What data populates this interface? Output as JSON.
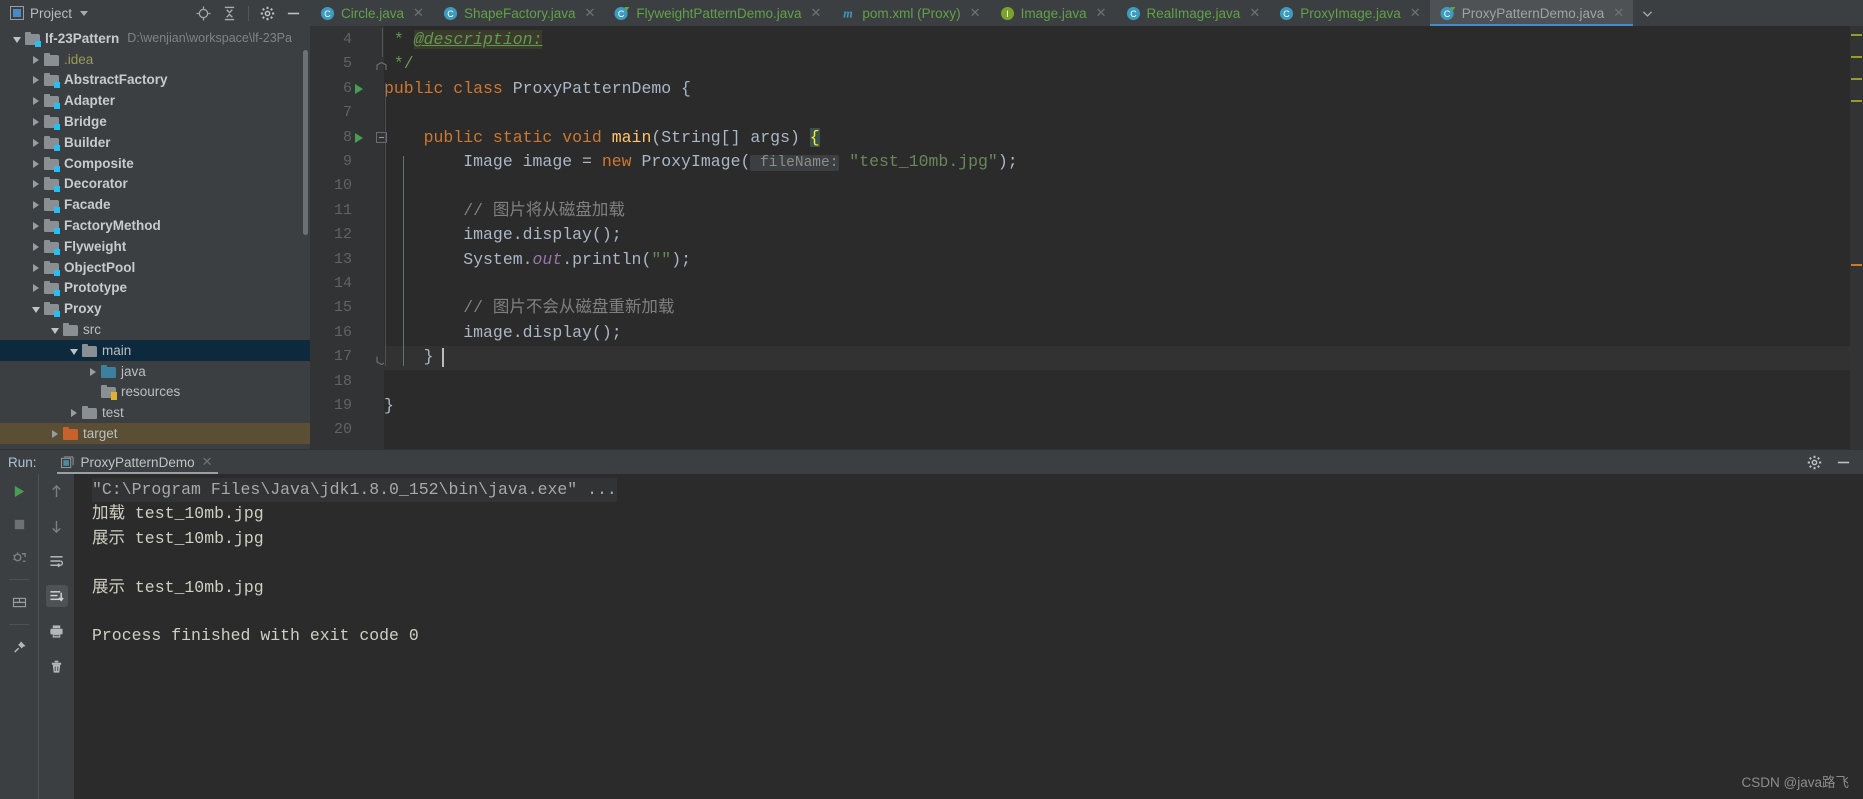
{
  "window": {
    "project_tool_label": "Project",
    "accent": "#4a88c7",
    "editor_bg": "#2b2b2b",
    "panel_bg": "#3c3f41"
  },
  "project_toolbar": {
    "locate_icon": "crosshair-locate-icon",
    "collapse_icon": "collapse-all-icon",
    "settings_icon": "gear-icon",
    "hide_icon": "minimize-icon"
  },
  "tabs": [
    {
      "label": "Circle.java",
      "icon": "java-class-icon",
      "type": "class",
      "active": false
    },
    {
      "label": "ShapeFactory.java",
      "icon": "java-class-icon",
      "type": "class",
      "active": false
    },
    {
      "label": "FlyweightPatternDemo.java",
      "icon": "java-runnable-class-icon",
      "type": "runnable",
      "active": false
    },
    {
      "label": "pom.xml (Proxy)",
      "icon": "maven-icon",
      "type": "maven",
      "active": false
    },
    {
      "label": "Image.java",
      "icon": "java-interface-icon",
      "type": "interface",
      "active": false
    },
    {
      "label": "RealImage.java",
      "icon": "java-class-icon",
      "type": "class",
      "active": false
    },
    {
      "label": "ProxyImage.java",
      "icon": "java-class-icon",
      "type": "class",
      "active": false
    },
    {
      "label": "ProxyPatternDemo.java",
      "icon": "java-runnable-class-icon",
      "type": "runnable",
      "active": true
    }
  ],
  "tabs_overflow_icon": "chevron-down-icon",
  "tree": [
    {
      "label": "lf-23Pattern",
      "path": "D:\\wenjian\\workspace\\lf-23Pa",
      "depth": 0,
      "state": "expanded",
      "icon": "module-folder-icon",
      "bold": true
    },
    {
      "label": ".idea",
      "depth": 1,
      "state": "collapsed",
      "icon": "folder-icon",
      "style": "idea"
    },
    {
      "label": "AbstractFactory",
      "depth": 1,
      "state": "collapsed",
      "icon": "module-folder-icon",
      "bold": true
    },
    {
      "label": "Adapter",
      "depth": 1,
      "state": "collapsed",
      "icon": "module-folder-icon",
      "bold": true
    },
    {
      "label": "Bridge",
      "depth": 1,
      "state": "collapsed",
      "icon": "module-folder-icon",
      "bold": true
    },
    {
      "label": "Builder",
      "depth": 1,
      "state": "collapsed",
      "icon": "module-folder-icon",
      "bold": true
    },
    {
      "label": "Composite",
      "depth": 1,
      "state": "collapsed",
      "icon": "module-folder-icon",
      "bold": true
    },
    {
      "label": "Decorator",
      "depth": 1,
      "state": "collapsed",
      "icon": "module-folder-icon",
      "bold": true
    },
    {
      "label": "Facade",
      "depth": 1,
      "state": "collapsed",
      "icon": "module-folder-icon",
      "bold": true
    },
    {
      "label": "FactoryMethod",
      "depth": 1,
      "state": "collapsed",
      "icon": "module-folder-icon",
      "bold": true
    },
    {
      "label": "Flyweight",
      "depth": 1,
      "state": "collapsed",
      "icon": "module-folder-icon",
      "bold": true
    },
    {
      "label": "ObjectPool",
      "depth": 1,
      "state": "collapsed",
      "icon": "module-folder-icon",
      "bold": true
    },
    {
      "label": "Prototype",
      "depth": 1,
      "state": "collapsed",
      "icon": "module-folder-icon",
      "bold": true
    },
    {
      "label": "Proxy",
      "depth": 1,
      "state": "expanded",
      "icon": "module-folder-icon",
      "bold": true
    },
    {
      "label": "src",
      "depth": 2,
      "state": "expanded",
      "icon": "folder-icon"
    },
    {
      "label": "main",
      "depth": 3,
      "state": "expanded",
      "icon": "folder-icon",
      "selected": true
    },
    {
      "label": "java",
      "depth": 4,
      "state": "collapsed",
      "icon": "source-root-icon"
    },
    {
      "label": "resources",
      "depth": 4,
      "state": "leaf",
      "icon": "resource-root-icon"
    },
    {
      "label": "test",
      "depth": 3,
      "state": "collapsed",
      "icon": "folder-icon"
    },
    {
      "label": "target",
      "depth": 2,
      "state": "collapsed",
      "icon": "excluded-folder-icon",
      "selected_target": true
    }
  ],
  "editor": {
    "first_line": 4,
    "last_line": 20,
    "caret_line": 17,
    "lines": [
      {
        "n": 4,
        "runmark": false,
        "tokens": [
          {
            "t": " * ",
            "c": "jd"
          },
          {
            "t": "@description:",
            "c": "jdtag"
          }
        ]
      },
      {
        "n": 5,
        "runmark": false,
        "tokens": [
          {
            "t": " */",
            "c": "jd"
          }
        ]
      },
      {
        "n": 6,
        "runmark": true,
        "tokens": [
          {
            "t": "public class ",
            "c": "k"
          },
          {
            "t": "ProxyPatternDemo {",
            "c": "t"
          }
        ]
      },
      {
        "n": 7,
        "runmark": false,
        "tokens": []
      },
      {
        "n": 8,
        "runmark": true,
        "tokens": [
          {
            "t": "    ",
            "c": "t"
          },
          {
            "t": "public static void ",
            "c": "k"
          },
          {
            "t": "main",
            "c": "mth"
          },
          {
            "t": "(String[] args) ",
            "c": "t"
          },
          {
            "t": "{",
            "c": "brace-hl"
          }
        ]
      },
      {
        "n": 9,
        "runmark": false,
        "tokens": [
          {
            "t": "        Image image = ",
            "c": "t"
          },
          {
            "t": "new ",
            "c": "k"
          },
          {
            "t": "ProxyImage(",
            "c": "t"
          },
          {
            "t": " fileName:",
            "c": "hint"
          },
          {
            "t": " ",
            "c": "t"
          },
          {
            "t": "\"test_10mb.jpg\"",
            "c": "s"
          },
          {
            "t": ");",
            "c": "t"
          }
        ]
      },
      {
        "n": 10,
        "runmark": false,
        "tokens": []
      },
      {
        "n": 11,
        "runmark": false,
        "tokens": [
          {
            "t": "        // 图片将从磁盘加载",
            "c": "cm"
          }
        ]
      },
      {
        "n": 12,
        "runmark": false,
        "tokens": [
          {
            "t": "        image.display();",
            "c": "t"
          }
        ]
      },
      {
        "n": 13,
        "runmark": false,
        "tokens": [
          {
            "t": "        System.",
            "c": "t"
          },
          {
            "t": "out",
            "c": "fld"
          },
          {
            "t": ".println(",
            "c": "t"
          },
          {
            "t": "\"\"",
            "c": "s"
          },
          {
            "t": ");",
            "c": "t"
          }
        ]
      },
      {
        "n": 14,
        "runmark": false,
        "tokens": []
      },
      {
        "n": 15,
        "runmark": false,
        "tokens": [
          {
            "t": "        // 图片不会从磁盘重新加载",
            "c": "cm"
          }
        ]
      },
      {
        "n": 16,
        "runmark": false,
        "tokens": [
          {
            "t": "        image.display();",
            "c": "t"
          }
        ]
      },
      {
        "n": 17,
        "runmark": false,
        "tokens": [
          {
            "t": "    }",
            "c": "t"
          }
        ]
      },
      {
        "n": 18,
        "runmark": false,
        "tokens": []
      },
      {
        "n": 19,
        "runmark": false,
        "tokens": [
          {
            "t": "}",
            "c": "t"
          }
        ]
      },
      {
        "n": 20,
        "runmark": false,
        "tokens": []
      }
    ],
    "marker_colors": [
      "#9a9c28",
      "#9a9c28",
      "#9a9c28",
      "#9a9c28",
      "#cc7832"
    ]
  },
  "run_panel": {
    "label": "Run:",
    "tab_label": "ProxyPatternDemo",
    "tab_icon": "run-configuration-icon",
    "close_icon": "close-icon",
    "settings_icon": "gear-icon",
    "minimize_icon": "minimize-icon",
    "toolbar_left": [
      {
        "icon": "rerun-play-icon",
        "name": "rerun-button"
      },
      {
        "icon": "stop-square-icon",
        "name": "stop-button"
      },
      {
        "icon": "rerun-failed-tests-icon",
        "name": "rerun-failed-button"
      },
      {
        "icon": "layout-toggle-icon",
        "name": "layout-button"
      },
      {
        "icon": "pin-tab-icon",
        "name": "pin-button"
      }
    ],
    "toolbar_right": [
      {
        "icon": "arrow-up-icon",
        "name": "prev-occurrence-button"
      },
      {
        "icon": "arrow-down-icon",
        "name": "next-occurrence-button"
      },
      {
        "icon": "soft-wrap-icon",
        "name": "soft-wrap-button"
      },
      {
        "icon": "scroll-to-end-icon",
        "name": "scroll-to-end-button",
        "active": true
      },
      {
        "icon": "print-icon",
        "name": "print-button"
      },
      {
        "icon": "trash-icon",
        "name": "clear-all-button"
      }
    ],
    "console_lines": [
      {
        "text": "\"C:\\Program Files\\Java\\jdk1.8.0_152\\bin\\java.exe\" ...",
        "style": "cmd"
      },
      {
        "text": "加载 test_10mb.jpg",
        "style": "out"
      },
      {
        "text": "展示 test_10mb.jpg",
        "style": "out"
      },
      {
        "text": "",
        "style": "out"
      },
      {
        "text": "展示 test_10mb.jpg",
        "style": "out"
      },
      {
        "text": "",
        "style": "out"
      },
      {
        "text": "Process finished with exit code 0",
        "style": "out"
      }
    ]
  },
  "watermark": "CSDN @java路飞"
}
